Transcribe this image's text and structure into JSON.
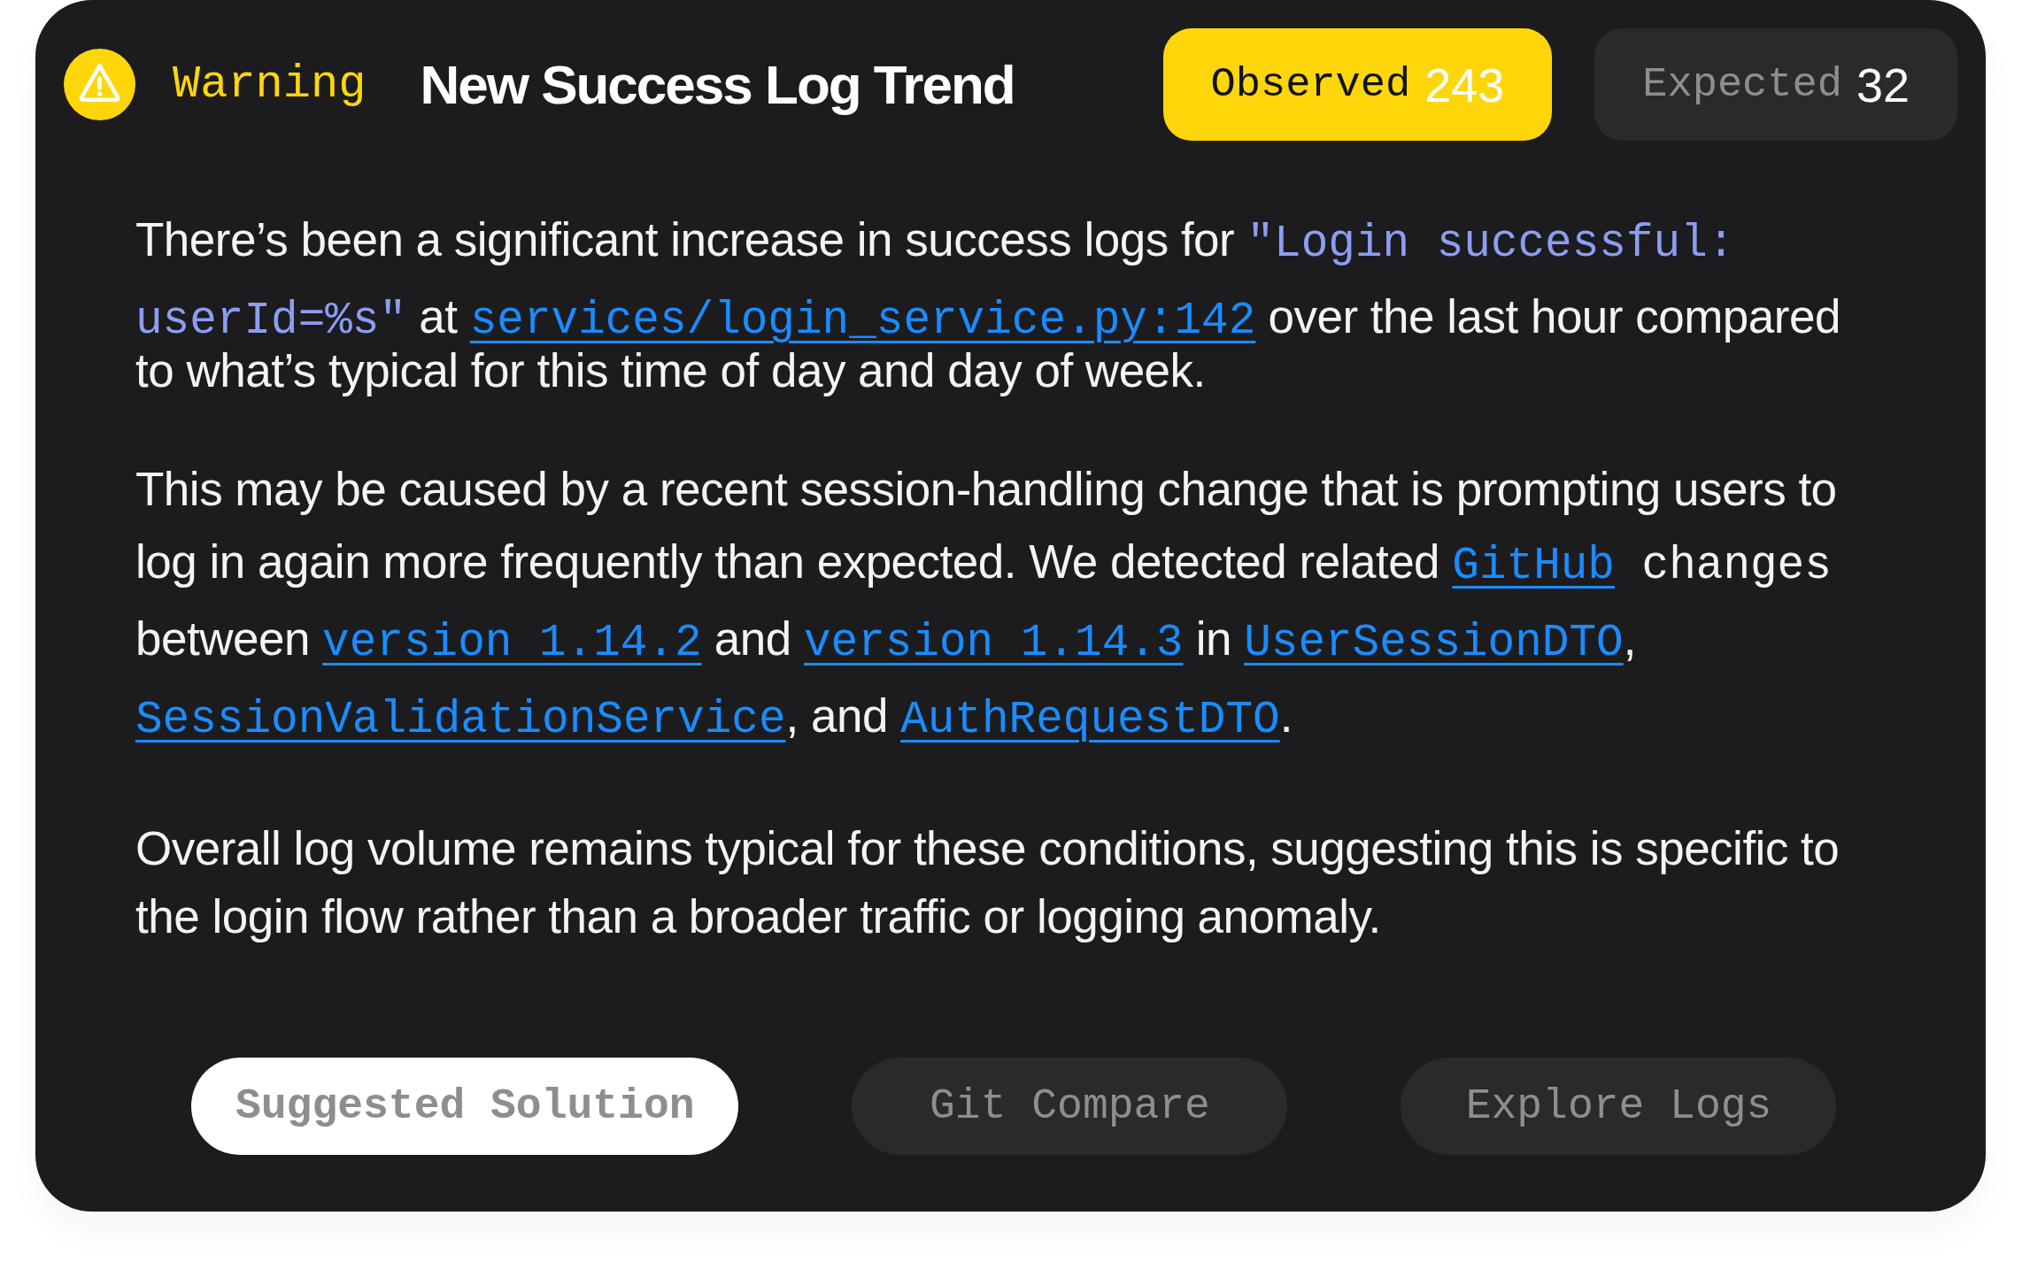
{
  "alert": {
    "severity": {
      "kind": "warning",
      "label": "Warning"
    },
    "title": "New Success Log Trend",
    "metrics": [
      {
        "label": "Observed",
        "value": "243",
        "highlighted": true
      },
      {
        "label": "Expected",
        "value": "32",
        "highlighted": false
      }
    ],
    "paragraphs": [
      {
        "segments": [
          {
            "kind": "text",
            "text": "There’s been a significant increase in success logs for "
          },
          {
            "kind": "code",
            "text": "\"Login successful: userId=%s\""
          },
          {
            "kind": "text",
            "text": " at "
          },
          {
            "kind": "link",
            "text": "services/login_service.py:142"
          },
          {
            "kind": "text",
            "text": " over the last hour compared to what’s typical for this time of day and day of week."
          }
        ]
      },
      {
        "segments": [
          {
            "kind": "text",
            "text": "This may be caused by a recent session-handling change that is prompting users to log in again more frequently than expected. We detected related "
          },
          {
            "kind": "link",
            "text": "GitHub"
          },
          {
            "kind": "mono",
            "text": " changes"
          },
          {
            "kind": "text",
            "text": " between "
          },
          {
            "kind": "link",
            "text": "version 1.14.2"
          },
          {
            "kind": "text",
            "text": " and "
          },
          {
            "kind": "link",
            "text": "version 1.14.3"
          },
          {
            "kind": "text",
            "text": " in "
          },
          {
            "kind": "link",
            "text": "UserSessionDTO"
          },
          {
            "kind": "text",
            "text": ", "
          },
          {
            "kind": "link",
            "text": "SessionValidationService"
          },
          {
            "kind": "text",
            "text": ", and "
          },
          {
            "kind": "link",
            "text": "AuthRequestDTO"
          },
          {
            "kind": "text",
            "text": "."
          }
        ]
      },
      {
        "segments": [
          {
            "kind": "text",
            "text": "Overall log volume remains typical for these conditions, suggesting this is specific to the login flow rather than a broader traffic or logging anomaly."
          }
        ]
      }
    ],
    "actions": [
      {
        "label": "Suggested Solution",
        "selected": true
      },
      {
        "label": "Git Compare",
        "selected": false
      },
      {
        "label": "Explore Logs",
        "selected": false
      }
    ]
  }
}
